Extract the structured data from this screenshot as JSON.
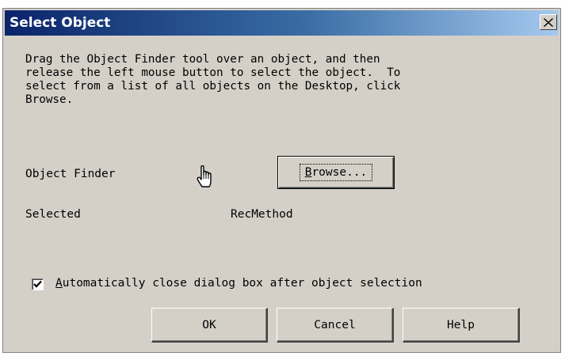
{
  "window": {
    "title": "Select Object",
    "close_icon": "close-icon"
  },
  "instructions": "Drag the Object Finder tool over an object, and then\nrelease the left mouse button to select the object.  To\nselect from a list of all objects on the Desktop, click\nBrowse.",
  "finder": {
    "label": "Object Finder",
    "tool_icon": "hand-pointer-icon"
  },
  "browse_button": {
    "accel": "B",
    "rest": "rowse..."
  },
  "selected": {
    "label": "Selected",
    "value": "RecMethod"
  },
  "auto_close": {
    "checked": true,
    "accel": "A",
    "rest": "utomatically close dialog box after object selection"
  },
  "buttons": {
    "ok": "OK",
    "cancel": "Cancel",
    "help": "Help"
  }
}
